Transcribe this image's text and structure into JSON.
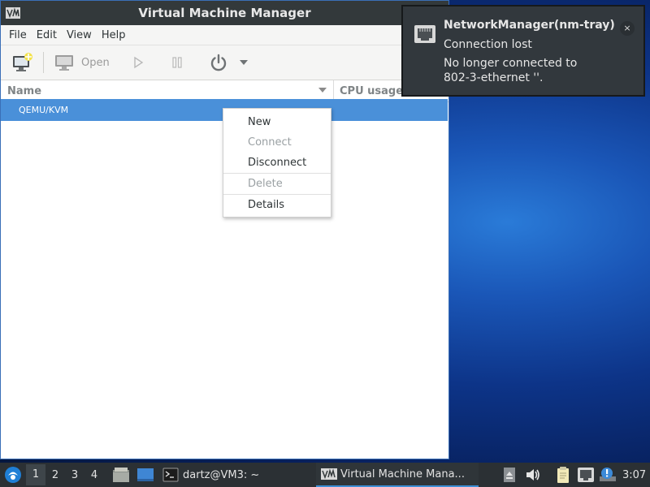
{
  "window": {
    "title": "Virtual Machine Manager",
    "menu": [
      "File",
      "Edit",
      "View",
      "Help"
    ],
    "toolbar": {
      "open_label": "Open"
    },
    "columns": {
      "name": "Name",
      "cpu": "CPU usage"
    },
    "connection": "QEMU/KVM"
  },
  "context_menu": {
    "items": [
      {
        "label": "New",
        "enabled": true
      },
      {
        "label": "Connect",
        "enabled": false
      },
      {
        "label": "Disconnect",
        "enabled": true
      },
      {
        "label": "Delete",
        "enabled": false
      },
      {
        "label": "Details",
        "enabled": true
      }
    ]
  },
  "notification": {
    "title": "NetworkManager(nm-tray)",
    "line1": "Connection lost",
    "line2": "No longer connected to",
    "line3": "802-3-ethernet ''.",
    "close": "×"
  },
  "taskbar": {
    "workspaces": [
      "1",
      "2",
      "3",
      "4"
    ],
    "active_workspace": "1",
    "terminal_task": "dartz@VM3: ~",
    "vmm_task": "Virtual Machine Mana...",
    "clock": "3:07"
  },
  "colors": {
    "selection": "#4a90d9",
    "titlebar": "#33393b",
    "taskbar": "#2b3034",
    "notification": "#32383d"
  }
}
